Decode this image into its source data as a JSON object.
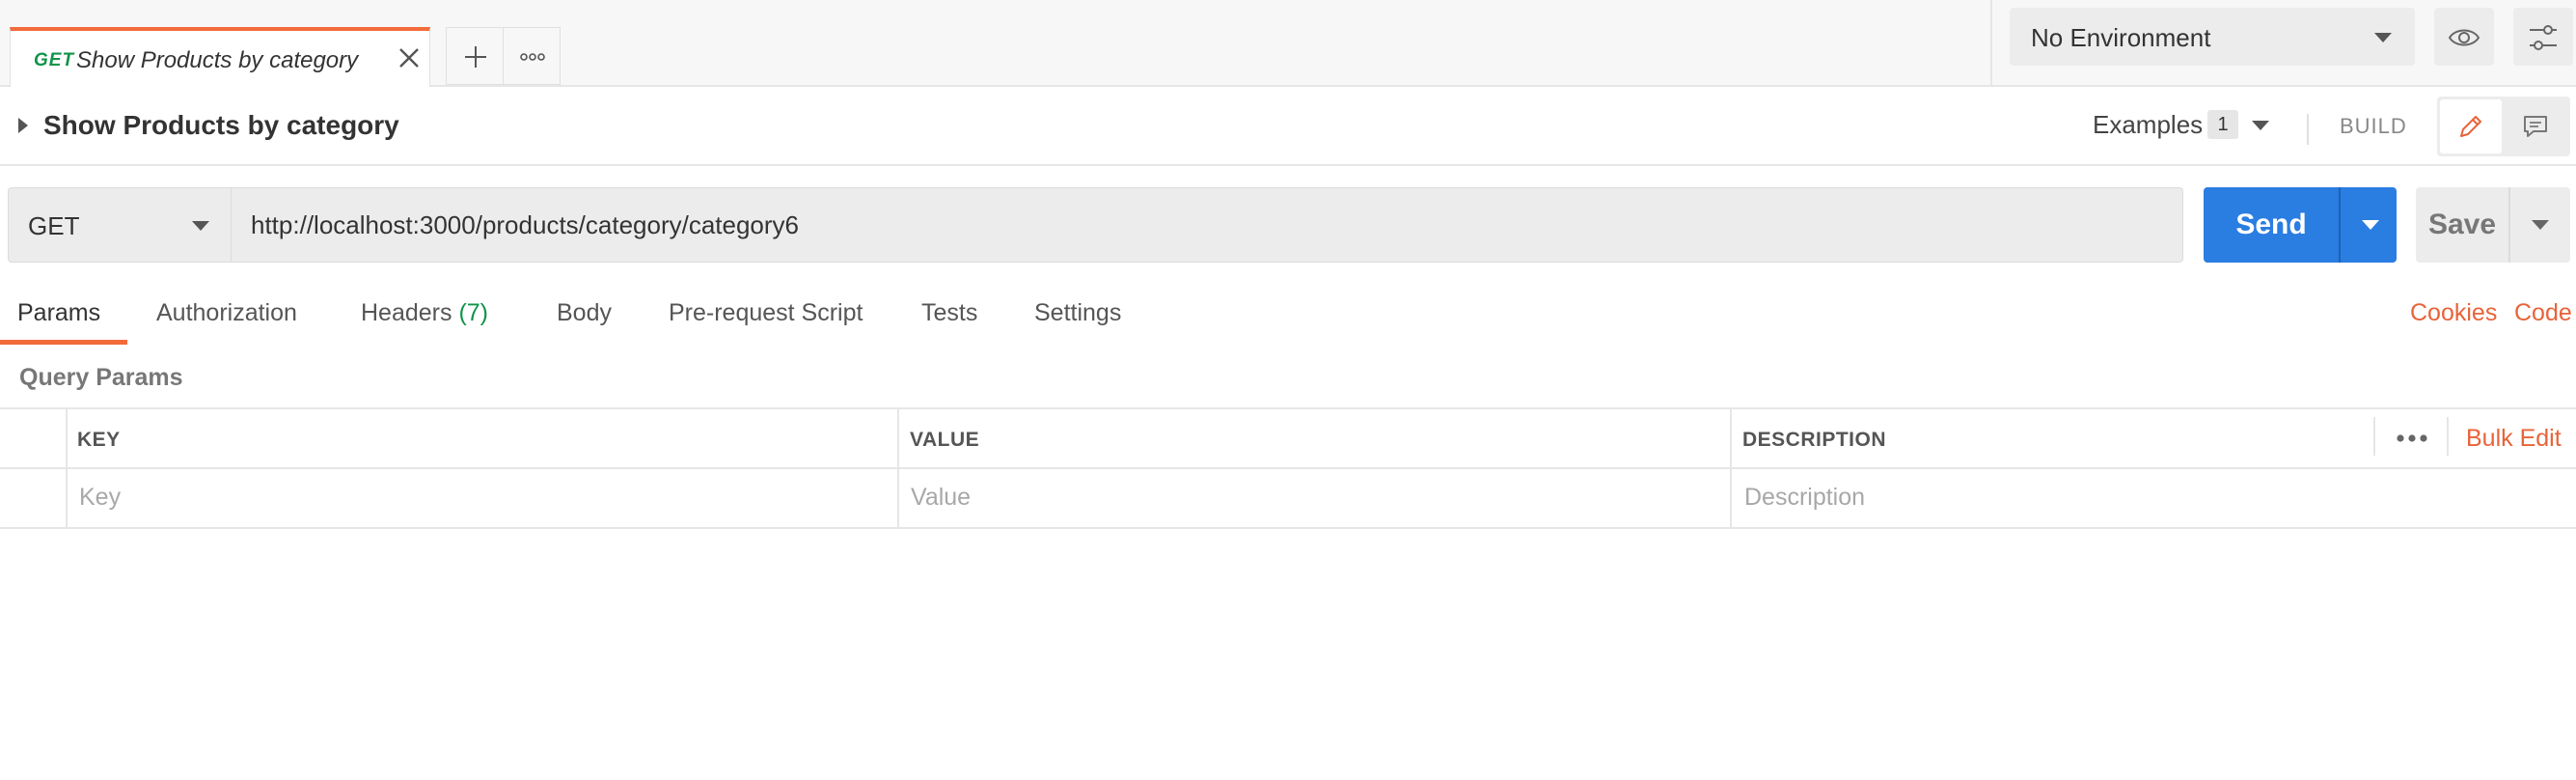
{
  "tabs": {
    "active": {
      "method": "GET",
      "name": "Show Products by category"
    }
  },
  "environment": {
    "selected": "No Environment"
  },
  "request": {
    "title": "Show Products by category",
    "examples_label": "Examples",
    "examples_count": "1",
    "build_label": "BUILD",
    "method": "GET",
    "url": "http://localhost:3000/products/category/category6",
    "send_label": "Send",
    "save_label": "Save"
  },
  "subtabs": {
    "params": "Params",
    "authorization": "Authorization",
    "headers": "Headers",
    "headers_count": "(7)",
    "body": "Body",
    "prerequest": "Pre-request Script",
    "tests": "Tests",
    "settings": "Settings",
    "cookies": "Cookies",
    "code": "Code"
  },
  "query_params": {
    "section_title": "Query Params",
    "columns": [
      "KEY",
      "VALUE",
      "DESCRIPTION"
    ],
    "bulk_edit": "Bulk Edit",
    "placeholders": {
      "key": "Key",
      "value": "Value",
      "description": "Description"
    }
  },
  "colors": {
    "accent": "#f26b3a",
    "send": "#2a7de1",
    "get_method": "#10944a"
  }
}
